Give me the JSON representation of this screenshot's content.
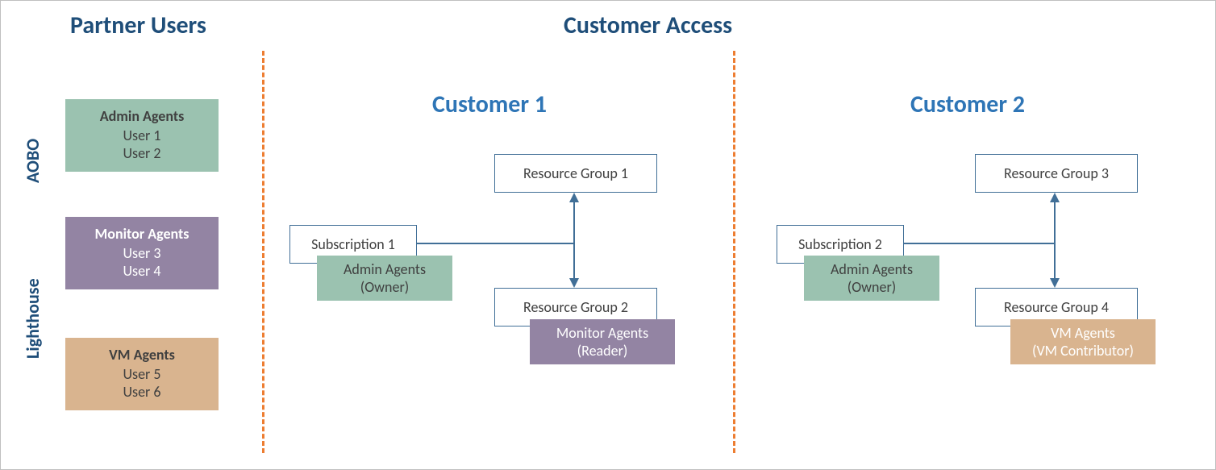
{
  "headers": {
    "partner": "Partner Users",
    "access": "Customer Access",
    "cust1": "Customer 1",
    "cust2": "Customer 2"
  },
  "sideLabels": {
    "aobo": "AOBO",
    "lighthouse": "Lighthouse"
  },
  "partnerGroups": {
    "admin": {
      "title": "Admin Agents",
      "u1": "User 1",
      "u2": "User 2"
    },
    "monitor": {
      "title": "Monitor Agents",
      "u1": "User 3",
      "u2": "User 4"
    },
    "vm": {
      "title": "VM Agents",
      "u1": "User 5",
      "u2": "User 6"
    }
  },
  "cust1": {
    "sub": "Subscription 1",
    "rg1": "Resource Group 1",
    "rg2": "Resource Group 2",
    "roleAdmin": {
      "l1": "Admin Agents",
      "l2": "(Owner)"
    },
    "roleMonitor": {
      "l1": "Monitor Agents",
      "l2": "(Reader)"
    }
  },
  "cust2": {
    "sub": "Subscription 2",
    "rg3": "Resource Group 3",
    "rg4": "Resource Group 4",
    "roleAdmin": {
      "l1": "Admin Agents",
      "l2": "(Owner)"
    },
    "roleVm": {
      "l1": "VM Agents",
      "l2": "(VM Contributor)"
    }
  }
}
